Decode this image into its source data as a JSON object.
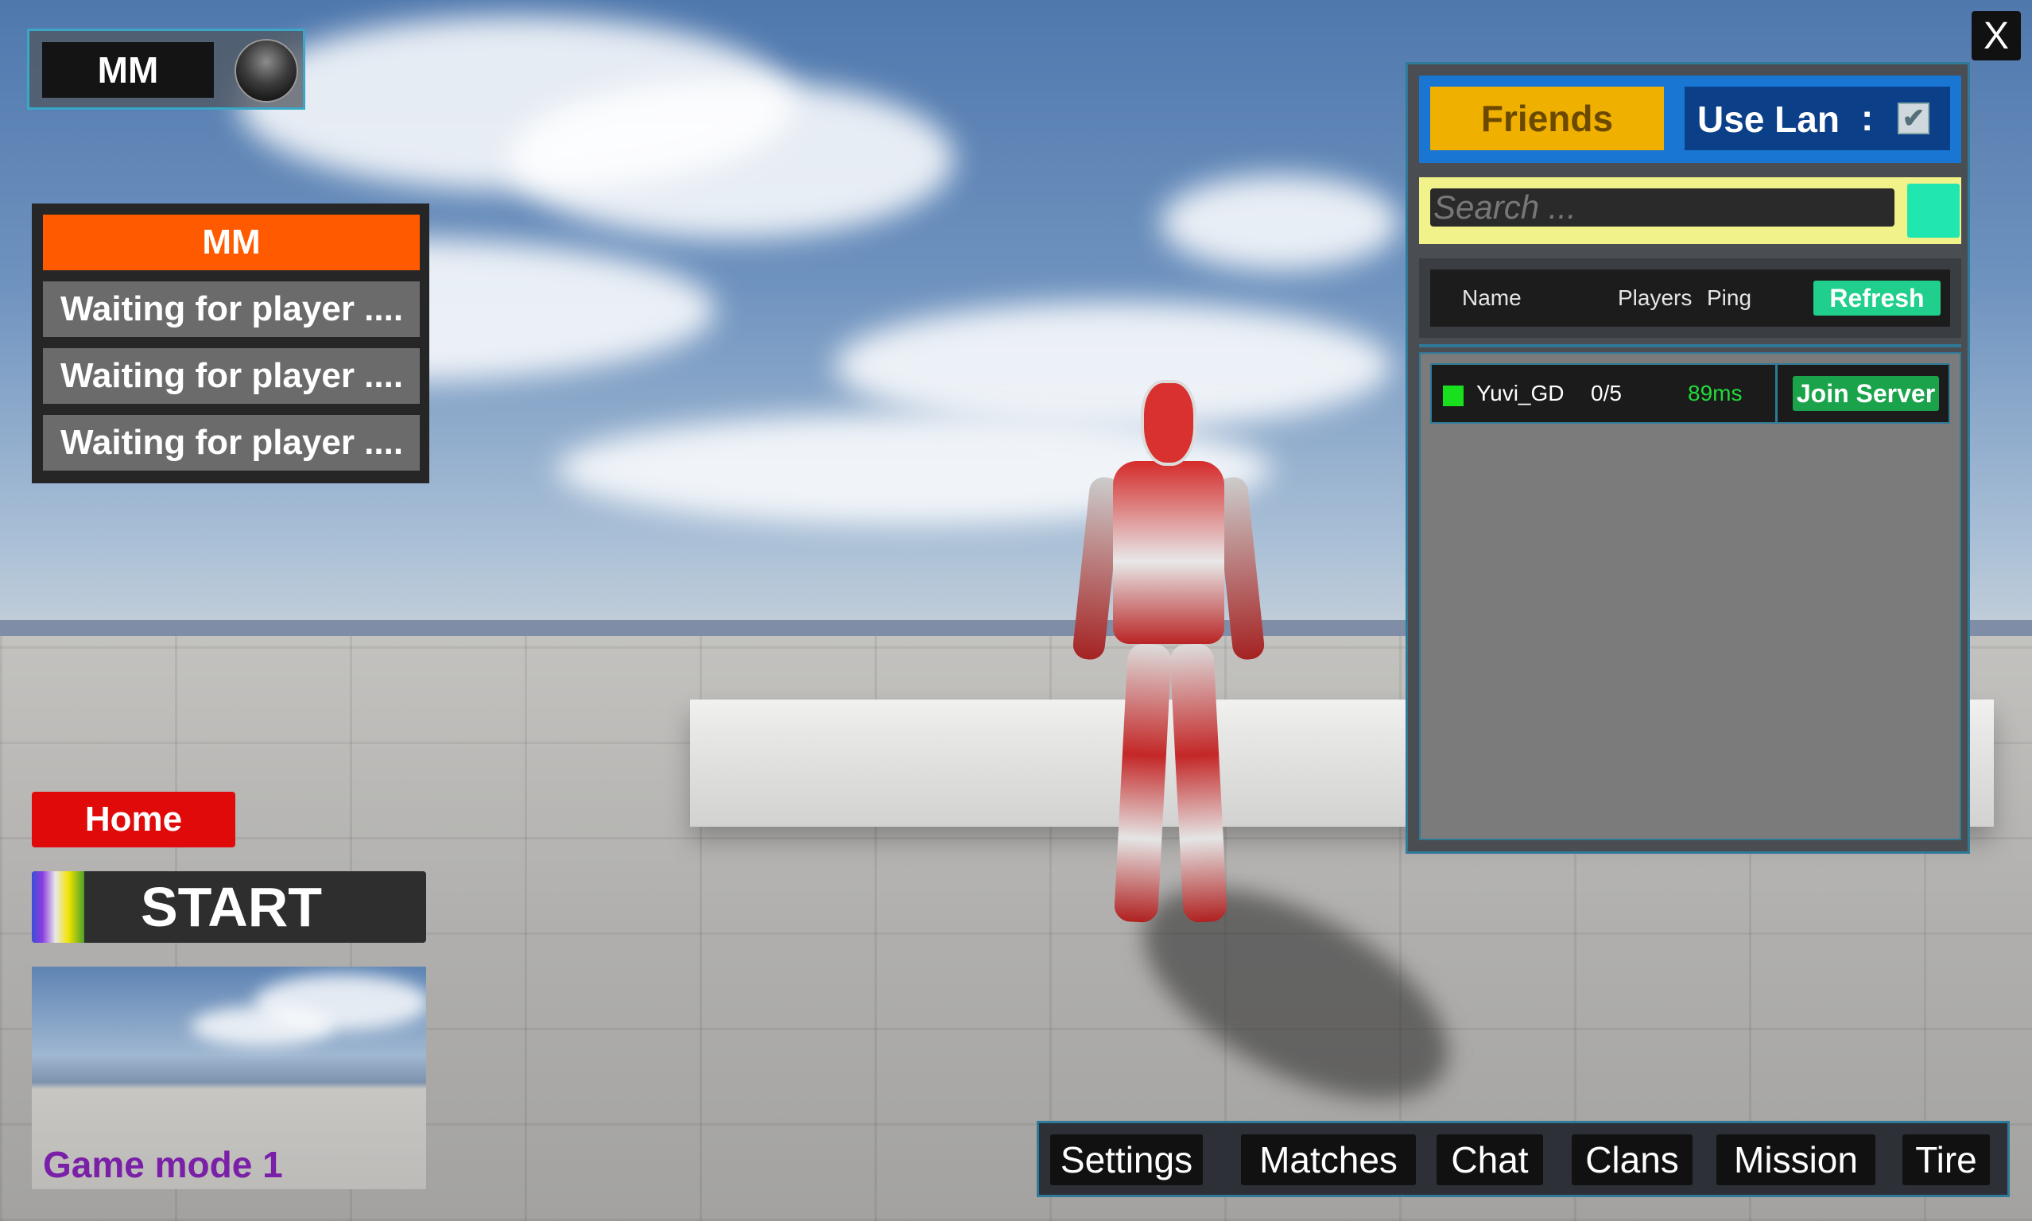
{
  "profile": {
    "name": "MM"
  },
  "lobby": {
    "title": "MM",
    "slots": [
      "Waiting for player ....",
      "Waiting for player ....",
      "Waiting for player ...."
    ]
  },
  "home_label": "Home",
  "start_label": "START",
  "game_mode": {
    "label": "Game mode 1"
  },
  "close_label": "X",
  "server_browser": {
    "friends_label": "Friends",
    "use_lan_label": "Use Lan",
    "use_lan_separator": ":",
    "use_lan_checked": true,
    "check_mark": "✔",
    "search_placeholder": "Search ...",
    "columns": {
      "name": "Name",
      "players": "Players",
      "ping": "Ping"
    },
    "refresh_label": "Refresh",
    "servers": [
      {
        "name": "Yuvi_GD",
        "players": "0/5",
        "ping": "89ms",
        "status_color": "#19e01c",
        "join_label": "Join Server"
      }
    ]
  },
  "nav": [
    "Settings",
    "Matches",
    "Chat",
    "Clans",
    "Mission",
    "Tire"
  ],
  "colors": {
    "lobby_title": "#ff5a00",
    "home": "#e00a0a",
    "friends": "#f0b000",
    "use_lan": "#0b3f88",
    "refresh": "#20cf8c",
    "join": "#1aa34a",
    "game_mode_text": "#7a1fa8"
  }
}
